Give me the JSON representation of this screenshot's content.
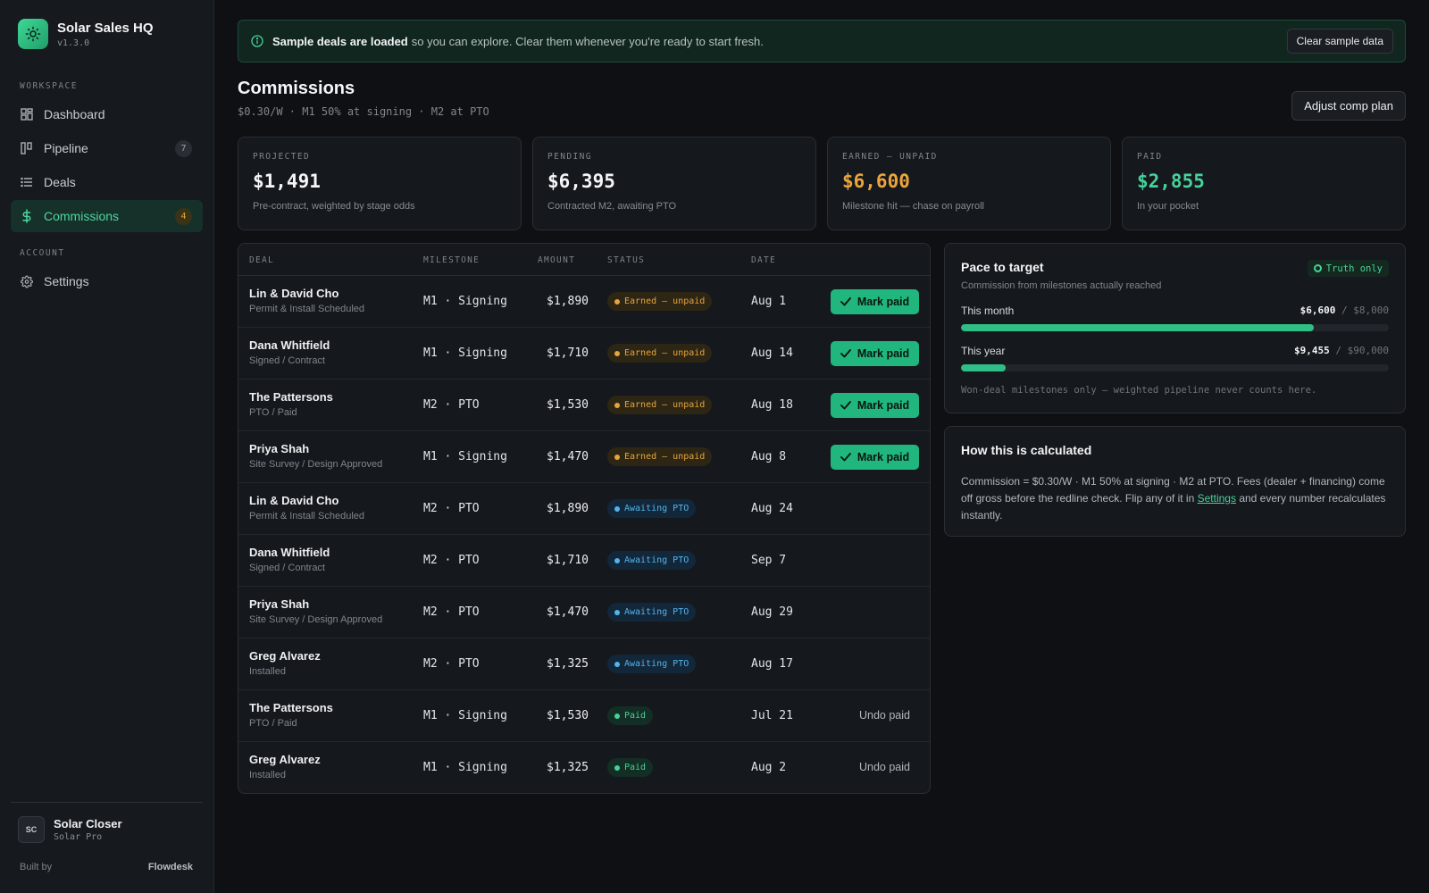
{
  "app": {
    "title": "Solar Sales HQ",
    "version": "v1.3.0"
  },
  "sidebar": {
    "workspace_label": "WORKSPACE",
    "account_label": "ACCOUNT",
    "items": [
      {
        "label": "Dashboard",
        "icon": "grid-icon"
      },
      {
        "label": "Pipeline",
        "icon": "kanban-icon",
        "badge": "7"
      },
      {
        "label": "Deals",
        "icon": "list-icon"
      },
      {
        "label": "Commissions",
        "icon": "dollar-icon",
        "badge": "4",
        "active": true
      },
      {
        "label": "Settings",
        "icon": "gear-icon"
      }
    ],
    "user": {
      "initials": "SC",
      "name": "Solar Closer",
      "role": "Solar Pro"
    },
    "built_by_label": "Built by",
    "built_by_brand": "Flowdesk"
  },
  "banner": {
    "strong": "Sample deals are loaded",
    "text": "so you can explore. Clear them whenever you're ready to start fresh.",
    "button": "Clear sample data"
  },
  "page": {
    "title": "Commissions",
    "subtitle": "$0.30/W · M1 50% at signing · M2 at PTO",
    "adjust_button": "Adjust comp plan"
  },
  "stats": [
    {
      "label": "PROJECTED",
      "value": "$1,491",
      "note": "Pre-contract, weighted by stage odds",
      "color": "#f4f6f8"
    },
    {
      "label": "PENDING",
      "value": "$6,395",
      "note": "Contracted M2, awaiting PTO",
      "color": "#f4f6f8"
    },
    {
      "label": "EARNED — UNPAID",
      "value": "$6,600",
      "note": "Milestone hit — chase on payroll",
      "color": "#eba53c"
    },
    {
      "label": "PAID",
      "value": "$2,855",
      "note": "In your pocket",
      "color": "#47d29b"
    }
  ],
  "table": {
    "headers": {
      "deal": "DEAL",
      "milestone": "MILESTONE",
      "amount": "AMOUNT",
      "status": "STATUS",
      "date": "DATE"
    },
    "rows": [
      {
        "name": "Lin & David Cho",
        "stage": "Permit & Install Scheduled",
        "milestone": "M1 · Signing",
        "amount": "$1,890",
        "status": "Earned — unpaid",
        "date": "Aug 1",
        "action": "Mark paid"
      },
      {
        "name": "Dana Whitfield",
        "stage": "Signed / Contract",
        "milestone": "M1 · Signing",
        "amount": "$1,710",
        "status": "Earned — unpaid",
        "date": "Aug 14",
        "action": "Mark paid"
      },
      {
        "name": "The Pattersons",
        "stage": "PTO / Paid",
        "milestone": "M2 · PTO",
        "amount": "$1,530",
        "status": "Earned — unpaid",
        "date": "Aug 18",
        "action": "Mark paid"
      },
      {
        "name": "Priya Shah",
        "stage": "Site Survey / Design Approved",
        "milestone": "M1 · Signing",
        "amount": "$1,470",
        "status": "Earned — unpaid",
        "date": "Aug 8",
        "action": "Mark paid"
      },
      {
        "name": "Lin & David Cho",
        "stage": "Permit & Install Scheduled",
        "milestone": "M2 · PTO",
        "amount": "$1,890",
        "status": "Awaiting PTO",
        "date": "Aug 24",
        "action": ""
      },
      {
        "name": "Dana Whitfield",
        "stage": "Signed / Contract",
        "milestone": "M2 · PTO",
        "amount": "$1,710",
        "status": "Awaiting PTO",
        "date": "Sep 7",
        "action": ""
      },
      {
        "name": "Priya Shah",
        "stage": "Site Survey / Design Approved",
        "milestone": "M2 · PTO",
        "amount": "$1,470",
        "status": "Awaiting PTO",
        "date": "Aug 29",
        "action": ""
      },
      {
        "name": "Greg Alvarez",
        "stage": "Installed",
        "milestone": "M2 · PTO",
        "amount": "$1,325",
        "status": "Awaiting PTO",
        "date": "Aug 17",
        "action": ""
      },
      {
        "name": "The Pattersons",
        "stage": "PTO / Paid",
        "milestone": "M1 · Signing",
        "amount": "$1,530",
        "status": "Paid",
        "date": "Jul 21",
        "action": "Undo paid"
      },
      {
        "name": "Greg Alvarez",
        "stage": "Installed",
        "milestone": "M1 · Signing",
        "amount": "$1,325",
        "status": "Paid",
        "date": "Aug 2",
        "action": "Undo paid"
      }
    ]
  },
  "pace": {
    "title": "Pace to target",
    "subtitle": "Commission from milestones actually reached",
    "badge": "Truth only",
    "month_label": "This month",
    "month_current": "$6,600",
    "month_target": "$8,000",
    "month_progress": 0.825,
    "year_label": "This year",
    "year_current": "$9,455",
    "year_target": "$90,000",
    "year_progress": 0.105,
    "separator": "/",
    "footnote": "Won-deal milestones only — weighted pipeline never counts here."
  },
  "calc": {
    "title": "How this is calculated",
    "text_before": "Commission = $0.30/W · M1 50% at signing · M2 at PTO. Fees (dealer + financing) come off gross before the redline check. Flip any of it in",
    "link": "Settings",
    "text_after": "and every number recalculates instantly."
  }
}
